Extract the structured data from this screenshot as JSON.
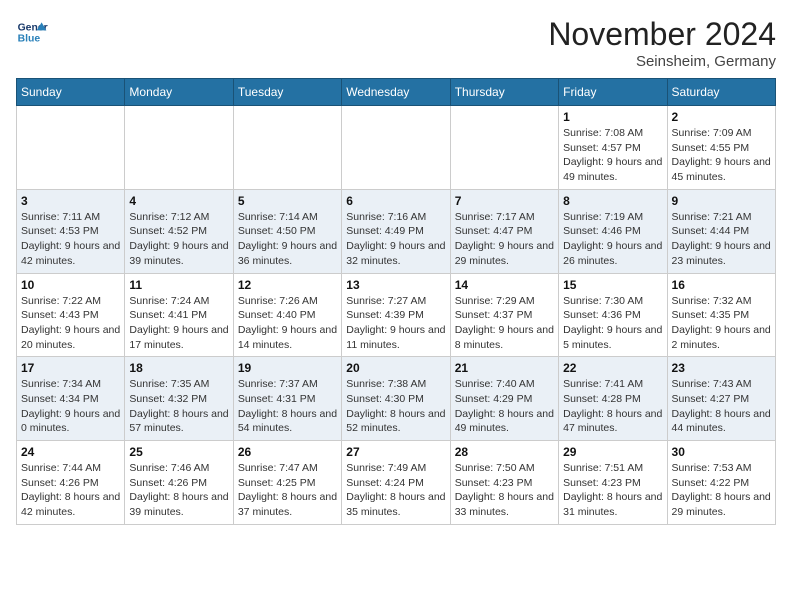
{
  "header": {
    "logo_line1": "General",
    "logo_line2": "Blue",
    "month": "November 2024",
    "location": "Seinsheim, Germany"
  },
  "weekdays": [
    "Sunday",
    "Monday",
    "Tuesday",
    "Wednesday",
    "Thursday",
    "Friday",
    "Saturday"
  ],
  "weeks": [
    [
      {
        "day": "",
        "sunrise": "",
        "sunset": "",
        "daylight": ""
      },
      {
        "day": "",
        "sunrise": "",
        "sunset": "",
        "daylight": ""
      },
      {
        "day": "",
        "sunrise": "",
        "sunset": "",
        "daylight": ""
      },
      {
        "day": "",
        "sunrise": "",
        "sunset": "",
        "daylight": ""
      },
      {
        "day": "",
        "sunrise": "",
        "sunset": "",
        "daylight": ""
      },
      {
        "day": "1",
        "sunrise": "Sunrise: 7:08 AM",
        "sunset": "Sunset: 4:57 PM",
        "daylight": "Daylight: 9 hours and 49 minutes."
      },
      {
        "day": "2",
        "sunrise": "Sunrise: 7:09 AM",
        "sunset": "Sunset: 4:55 PM",
        "daylight": "Daylight: 9 hours and 45 minutes."
      }
    ],
    [
      {
        "day": "3",
        "sunrise": "Sunrise: 7:11 AM",
        "sunset": "Sunset: 4:53 PM",
        "daylight": "Daylight: 9 hours and 42 minutes."
      },
      {
        "day": "4",
        "sunrise": "Sunrise: 7:12 AM",
        "sunset": "Sunset: 4:52 PM",
        "daylight": "Daylight: 9 hours and 39 minutes."
      },
      {
        "day": "5",
        "sunrise": "Sunrise: 7:14 AM",
        "sunset": "Sunset: 4:50 PM",
        "daylight": "Daylight: 9 hours and 36 minutes."
      },
      {
        "day": "6",
        "sunrise": "Sunrise: 7:16 AM",
        "sunset": "Sunset: 4:49 PM",
        "daylight": "Daylight: 9 hours and 32 minutes."
      },
      {
        "day": "7",
        "sunrise": "Sunrise: 7:17 AM",
        "sunset": "Sunset: 4:47 PM",
        "daylight": "Daylight: 9 hours and 29 minutes."
      },
      {
        "day": "8",
        "sunrise": "Sunrise: 7:19 AM",
        "sunset": "Sunset: 4:46 PM",
        "daylight": "Daylight: 9 hours and 26 minutes."
      },
      {
        "day": "9",
        "sunrise": "Sunrise: 7:21 AM",
        "sunset": "Sunset: 4:44 PM",
        "daylight": "Daylight: 9 hours and 23 minutes."
      }
    ],
    [
      {
        "day": "10",
        "sunrise": "Sunrise: 7:22 AM",
        "sunset": "Sunset: 4:43 PM",
        "daylight": "Daylight: 9 hours and 20 minutes."
      },
      {
        "day": "11",
        "sunrise": "Sunrise: 7:24 AM",
        "sunset": "Sunset: 4:41 PM",
        "daylight": "Daylight: 9 hours and 17 minutes."
      },
      {
        "day": "12",
        "sunrise": "Sunrise: 7:26 AM",
        "sunset": "Sunset: 4:40 PM",
        "daylight": "Daylight: 9 hours and 14 minutes."
      },
      {
        "day": "13",
        "sunrise": "Sunrise: 7:27 AM",
        "sunset": "Sunset: 4:39 PM",
        "daylight": "Daylight: 9 hours and 11 minutes."
      },
      {
        "day": "14",
        "sunrise": "Sunrise: 7:29 AM",
        "sunset": "Sunset: 4:37 PM",
        "daylight": "Daylight: 9 hours and 8 minutes."
      },
      {
        "day": "15",
        "sunrise": "Sunrise: 7:30 AM",
        "sunset": "Sunset: 4:36 PM",
        "daylight": "Daylight: 9 hours and 5 minutes."
      },
      {
        "day": "16",
        "sunrise": "Sunrise: 7:32 AM",
        "sunset": "Sunset: 4:35 PM",
        "daylight": "Daylight: 9 hours and 2 minutes."
      }
    ],
    [
      {
        "day": "17",
        "sunrise": "Sunrise: 7:34 AM",
        "sunset": "Sunset: 4:34 PM",
        "daylight": "Daylight: 9 hours and 0 minutes."
      },
      {
        "day": "18",
        "sunrise": "Sunrise: 7:35 AM",
        "sunset": "Sunset: 4:32 PM",
        "daylight": "Daylight: 8 hours and 57 minutes."
      },
      {
        "day": "19",
        "sunrise": "Sunrise: 7:37 AM",
        "sunset": "Sunset: 4:31 PM",
        "daylight": "Daylight: 8 hours and 54 minutes."
      },
      {
        "day": "20",
        "sunrise": "Sunrise: 7:38 AM",
        "sunset": "Sunset: 4:30 PM",
        "daylight": "Daylight: 8 hours and 52 minutes."
      },
      {
        "day": "21",
        "sunrise": "Sunrise: 7:40 AM",
        "sunset": "Sunset: 4:29 PM",
        "daylight": "Daylight: 8 hours and 49 minutes."
      },
      {
        "day": "22",
        "sunrise": "Sunrise: 7:41 AM",
        "sunset": "Sunset: 4:28 PM",
        "daylight": "Daylight: 8 hours and 47 minutes."
      },
      {
        "day": "23",
        "sunrise": "Sunrise: 7:43 AM",
        "sunset": "Sunset: 4:27 PM",
        "daylight": "Daylight: 8 hours and 44 minutes."
      }
    ],
    [
      {
        "day": "24",
        "sunrise": "Sunrise: 7:44 AM",
        "sunset": "Sunset: 4:26 PM",
        "daylight": "Daylight: 8 hours and 42 minutes."
      },
      {
        "day": "25",
        "sunrise": "Sunrise: 7:46 AM",
        "sunset": "Sunset: 4:26 PM",
        "daylight": "Daylight: 8 hours and 39 minutes."
      },
      {
        "day": "26",
        "sunrise": "Sunrise: 7:47 AM",
        "sunset": "Sunset: 4:25 PM",
        "daylight": "Daylight: 8 hours and 37 minutes."
      },
      {
        "day": "27",
        "sunrise": "Sunrise: 7:49 AM",
        "sunset": "Sunset: 4:24 PM",
        "daylight": "Daylight: 8 hours and 35 minutes."
      },
      {
        "day": "28",
        "sunrise": "Sunrise: 7:50 AM",
        "sunset": "Sunset: 4:23 PM",
        "daylight": "Daylight: 8 hours and 33 minutes."
      },
      {
        "day": "29",
        "sunrise": "Sunrise: 7:51 AM",
        "sunset": "Sunset: 4:23 PM",
        "daylight": "Daylight: 8 hours and 31 minutes."
      },
      {
        "day": "30",
        "sunrise": "Sunrise: 7:53 AM",
        "sunset": "Sunset: 4:22 PM",
        "daylight": "Daylight: 8 hours and 29 minutes."
      }
    ]
  ]
}
